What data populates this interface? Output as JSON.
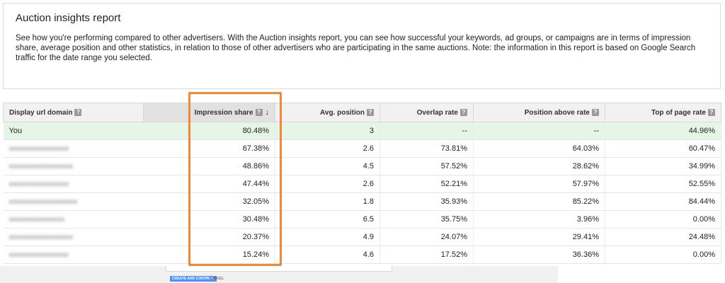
{
  "report": {
    "title": "Auction insights report",
    "description": "See how you're performing compared to other advertisers. With the Auction insights report, you can see how successful your keywords, ad groups, or campaigns are in terms of impression share, average position and other statistics, in relation to those of other advertisers who are participating in the same auctions. Note: the information in this report is based on Google Search traffic for the date range you selected."
  },
  "table": {
    "headers": {
      "domain": "Display url domain",
      "impression_share": "Impression share",
      "avg_position": "Avg. position",
      "overlap_rate": "Overlap rate",
      "position_above_rate": "Position above rate",
      "top_of_page_rate": "Top of page rate"
    },
    "help_glyph": "?",
    "sort_glyph": "↓",
    "sorted_column": "impression_share",
    "rows": [
      {
        "domain": "You",
        "impression_share": "80.48%",
        "avg_position": "3",
        "overlap_rate": "--",
        "position_above_rate": "--",
        "top_of_page_rate": "44.96%"
      },
      {
        "domain": "",
        "impression_share": "67.38%",
        "avg_position": "2.6",
        "overlap_rate": "73.81%",
        "position_above_rate": "64.03%",
        "top_of_page_rate": "60.47%"
      },
      {
        "domain": "",
        "impression_share": "48.86%",
        "avg_position": "4.5",
        "overlap_rate": "57.52%",
        "position_above_rate": "28.62%",
        "top_of_page_rate": "34.99%"
      },
      {
        "domain": "",
        "impression_share": "47.44%",
        "avg_position": "2.6",
        "overlap_rate": "52.21%",
        "position_above_rate": "57.97%",
        "top_of_page_rate": "52.55%"
      },
      {
        "domain": "",
        "impression_share": "32.05%",
        "avg_position": "1.8",
        "overlap_rate": "35.93%",
        "position_above_rate": "85.22%",
        "top_of_page_rate": "84.44%"
      },
      {
        "domain": "",
        "impression_share": "30.48%",
        "avg_position": "6.5",
        "overlap_rate": "35.75%",
        "position_above_rate": "3.96%",
        "top_of_page_rate": "0.00%"
      },
      {
        "domain": "",
        "impression_share": "20.37%",
        "avg_position": "4.9",
        "overlap_rate": "24.07%",
        "position_above_rate": "29.41%",
        "top_of_page_rate": "24.48%"
      },
      {
        "domain": "",
        "impression_share": "15.24%",
        "avg_position": "4.6",
        "overlap_rate": "17.52%",
        "position_above_rate": "36.36%",
        "top_of_page_rate": "0.00%"
      }
    ]
  },
  "footer": {
    "create_label": "CREATE AND CONTINUE",
    "cancel_label": "CANCEL"
  },
  "colors": {
    "you_row": "#e6f6e6",
    "highlight": "#f0883a",
    "primary_button": "#4d90fe"
  },
  "icons": {
    "help": "help-icon",
    "sort": "sort-descending-icon"
  }
}
